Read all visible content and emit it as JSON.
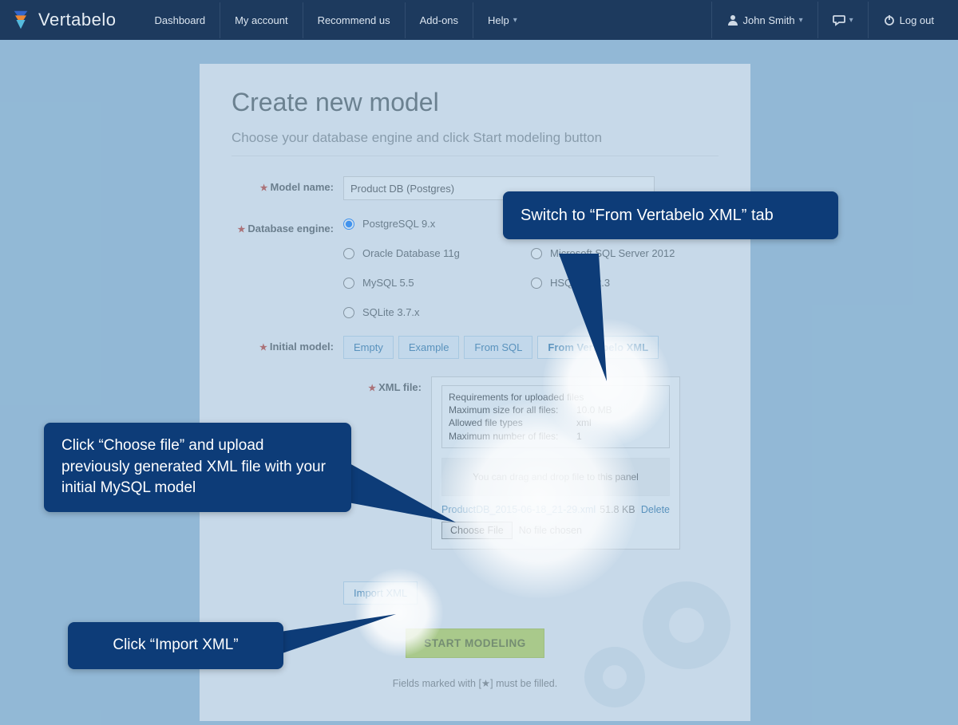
{
  "brand": "Vertabelo",
  "nav": {
    "dashboard": "Dashboard",
    "account": "My account",
    "recommend": "Recommend us",
    "addons": "Add-ons",
    "help": "Help"
  },
  "user": {
    "name": "John Smith",
    "logout": "Log out"
  },
  "page": {
    "title": "Create new model",
    "subtitle": "Choose your database engine and click Start modeling button",
    "labels": {
      "name": "Model name:",
      "engine": "Database engine:",
      "initial": "Initial model:",
      "xml": "XML file:"
    },
    "model_name": "Product DB (Postgres)",
    "engines": [
      "PostgreSQL 9.x",
      "Oracle Database 11g",
      "Microsoft SQL Server 2012",
      "MySQL 5.5",
      "HSQLDB 2.3",
      "SQLite 3.7.x"
    ],
    "tabs": {
      "empty": "Empty",
      "example": "Example",
      "sql": "From SQL",
      "xml": "From Vertabelo XML"
    },
    "req": {
      "title": "Requirements for uploaded files",
      "r1k": "Maximum size for all files:",
      "r1v": "10.0 MB",
      "r2k": "Allowed file types",
      "r2v": "xml",
      "r3k": "Maximum number of files:",
      "r3v": "1"
    },
    "drag": "You can drag and drop file to this panel",
    "file": {
      "name": "ProductDB_2015-06-18_21-29.xml",
      "size": "51.8 KB",
      "delete": "Delete"
    },
    "choose": "Choose File",
    "nofile": "No file chosen",
    "import": "Import XML",
    "start": "START MODELING",
    "footnote": "Fields marked with [★] must be filled."
  },
  "callouts": {
    "c1": "Switch to “From Vertabelo XML” tab",
    "c2": "Click “Choose file” and upload previously generated XML file with your initial MySQL model",
    "c3": "Click “Import XML”"
  }
}
